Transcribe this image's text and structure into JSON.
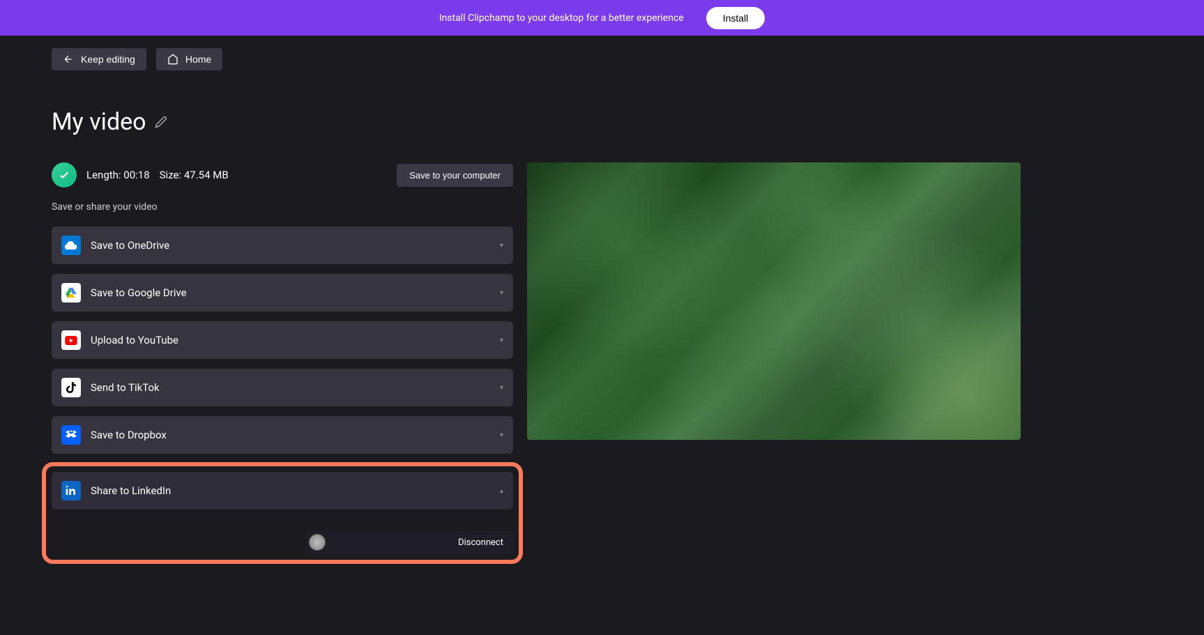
{
  "banner": {
    "text": "Install Clipchamp to your desktop for a better experience",
    "button": "Install"
  },
  "nav": {
    "keep_editing": "Keep editing",
    "home": "Home"
  },
  "title": "My video",
  "status": {
    "length_label": "Length:",
    "length_value": "00:18",
    "size_label": "Size:",
    "size_value": "47.54 MB",
    "save_computer": "Save to your computer"
  },
  "share_label": "Save or share your video",
  "share_options": {
    "onedrive": "Save to OneDrive",
    "gdrive": "Save to Google Drive",
    "youtube": "Upload to YouTube",
    "tiktok": "Send to TikTok",
    "dropbox": "Save to Dropbox",
    "linkedin": "Share to LinkedIn"
  },
  "linkedin_panel": {
    "disconnect": "Disconnect"
  }
}
